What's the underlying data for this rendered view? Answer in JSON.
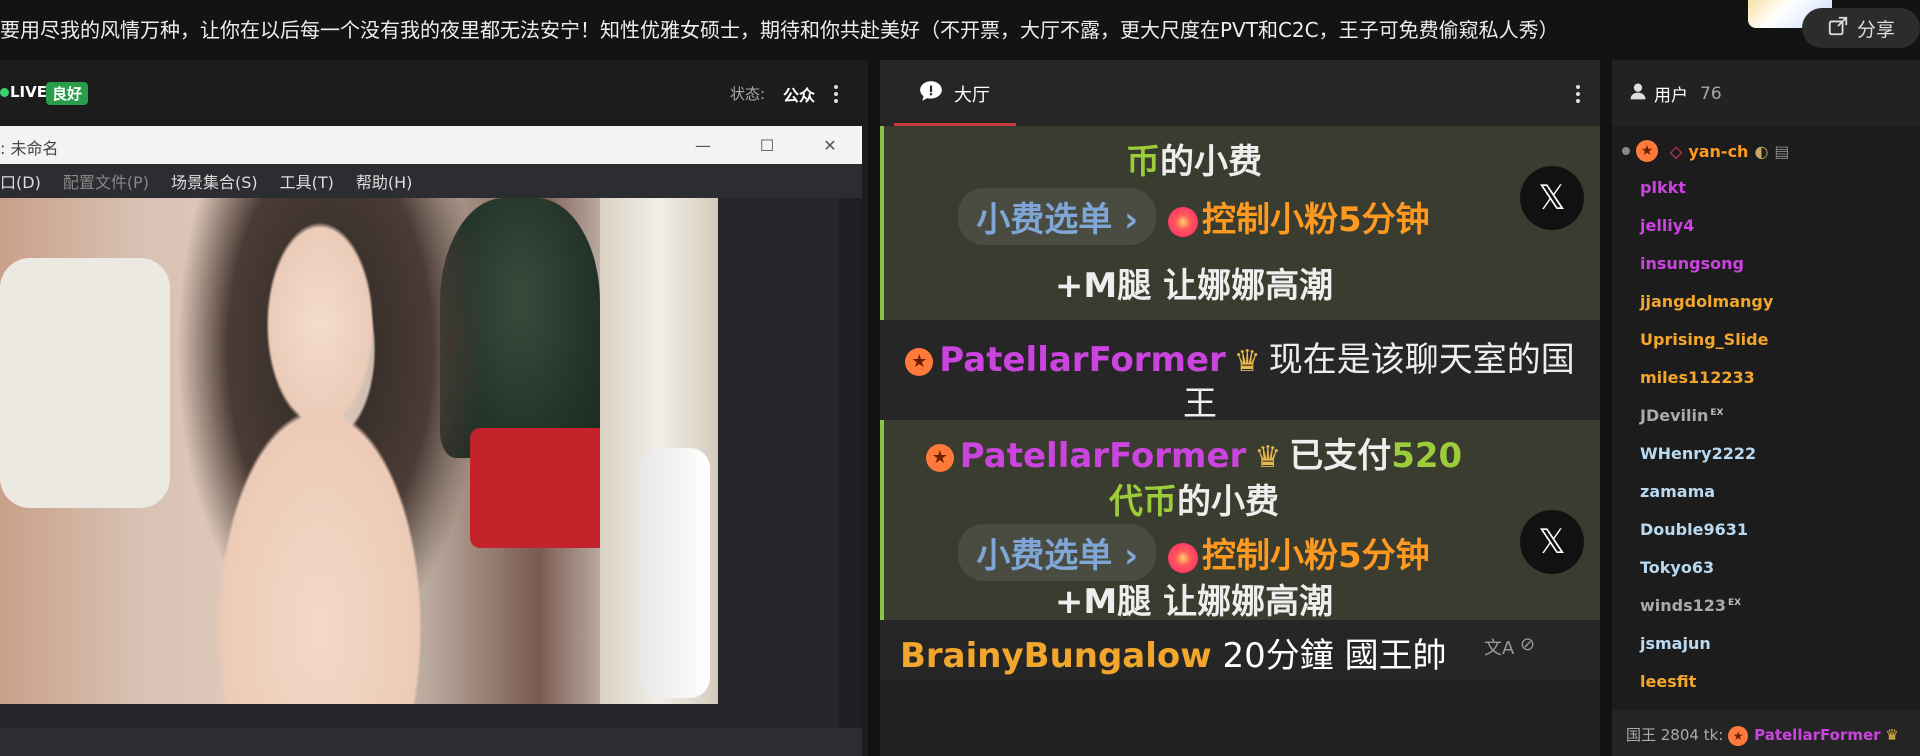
{
  "header": {
    "description": "要用尽我的风情万种，让你在以后每一个没有我的夜里都无法安宁！知性优雅女硕士，期待和你共赴美好（不开票，大厅不露，更大尺度在PVT和C2C，王子可免费偷窥私人秀）",
    "share_label": "分享"
  },
  "video": {
    "live_label": "LIVE",
    "quality_label": "良好",
    "status_label": "状态:",
    "status_value": "公众",
    "obs": {
      "title": ": 未命名",
      "menu": [
        "口(D)",
        "配置文件(P)",
        "场景集合(S)",
        "工具(T)",
        "帮助(H)"
      ]
    }
  },
  "chat": {
    "tab_label": "大厅",
    "tip1": {
      "line1_green": "币",
      "line1_rest": "的小费",
      "menu_label": "小费选单 ›",
      "control_label": "控制小粉5分钟",
      "line3": "+M腿 让娜娜高潮"
    },
    "king_msg": {
      "user": "PatellarFormer",
      "text_a": "现在是该聊天室的国",
      "text_b": "王"
    },
    "tip2": {
      "user": "PatellarFormer",
      "paid": "已支付",
      "amount": "520",
      "line2_green": "代币",
      "line2_rest": "的小费",
      "menu_label": "小费选单 ›",
      "control_label": "控制小粉5分钟",
      "line4": "+M腿 让娜娜高潮"
    },
    "plain_msg": {
      "user": "BrainyBungalow",
      "text": "20分鐘 國王帥"
    }
  },
  "users": {
    "title": "用户",
    "count": "76",
    "list": [
      {
        "name": "yan-ch",
        "color": "#ff9a1f"
      },
      {
        "name": "plkkt",
        "color": "#cc44e0"
      },
      {
        "name": "jelliy4",
        "color": "#cc44e0"
      },
      {
        "name": "insungsong",
        "color": "#cc44e0"
      },
      {
        "name": "jjangdolmangy",
        "color": "#f3a62c"
      },
      {
        "name": "Uprising_Slide",
        "color": "#f3a62c"
      },
      {
        "name": "miles112233",
        "color": "#f3a62c"
      },
      {
        "name": "JDevilin",
        "color": "#aaaaaa",
        "sup": "EX"
      },
      {
        "name": "WHenry2222",
        "color": "#b9d9f0"
      },
      {
        "name": "zamama",
        "color": "#b9d9f0"
      },
      {
        "name": "Double9631",
        "color": "#b9d9f0"
      },
      {
        "name": "Tokyo63",
        "color": "#b9d9f0"
      },
      {
        "name": "winds123",
        "color": "#aaaaaa",
        "sup": "EX"
      },
      {
        "name": "jsmajun",
        "color": "#b9d9f0"
      },
      {
        "name": "leesfit",
        "color": "#f3a62c"
      }
    ],
    "footer": {
      "prefix": "国王 2804 tk:",
      "king": "PatellarFormer"
    }
  },
  "colors": {
    "accent_green": "#9ccc3a",
    "accent_orange": "#ff9a1f",
    "accent_purple": "#cc44e0",
    "tab_underline": "#c23a3a"
  }
}
